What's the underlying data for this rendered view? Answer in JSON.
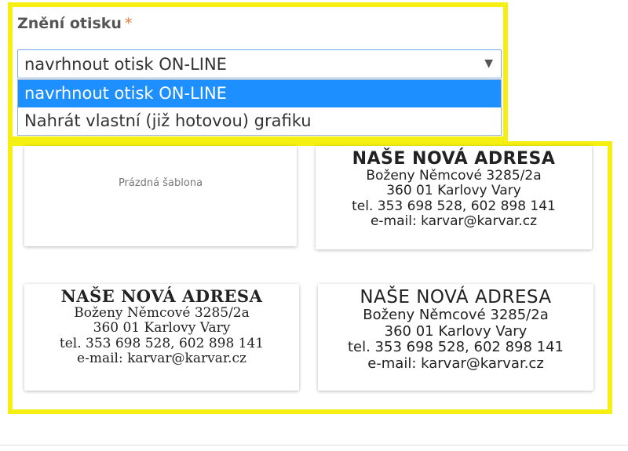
{
  "field": {
    "label": "Znění otisku",
    "required_mark": "*",
    "selected_value": "navrhnout otisk ON-LINE",
    "options": [
      "navrhnout otisk ON-LINE",
      "Nahrát vlastní (již hotovou) grafiku"
    ],
    "selected_index": 0
  },
  "templates": {
    "blank_label": "Prázdná šablona",
    "stamp": {
      "heading": "NAŠE NOVÁ ADRESA",
      "line1": "Boženy Němcové 3285/2a",
      "line2": "360 01 Karlovy Vary",
      "line3": "tel. 353 698 528, 602 898 141",
      "line4": "e-mail: karvar@karvar.cz"
    }
  },
  "colors": {
    "highlight": "#f5ef12",
    "selected_option": "#1e8fff",
    "required": "#e07b39"
  },
  "icons": {
    "dropdown": "caret-down-icon"
  }
}
